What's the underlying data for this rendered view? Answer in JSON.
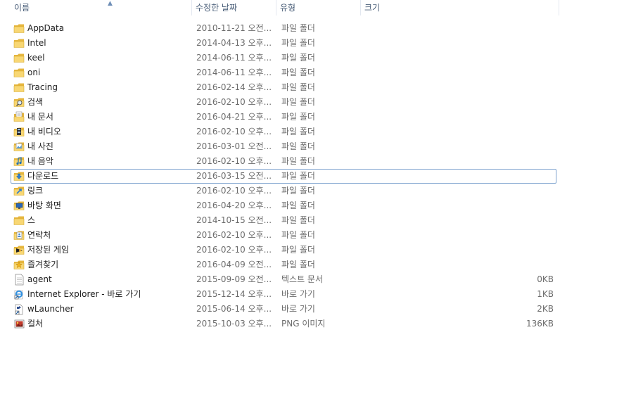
{
  "columns": {
    "name": "이름",
    "date": "수정한 날짜",
    "type": "유형",
    "size": "크기"
  },
  "colors": {
    "focus_border": "#7da2ce",
    "folder": "#f5cf5e",
    "header_text": "#4c607a",
    "detail_text": "#6d6d6d"
  },
  "items": [
    {
      "name": "AppData",
      "date": "2010-11-21 오전...",
      "type": "파일 폴더",
      "size": "",
      "icon": "folder-icon"
    },
    {
      "name": "Intel",
      "date": "2014-04-13 오후...",
      "type": "파일 폴더",
      "size": "",
      "icon": "folder-icon"
    },
    {
      "name": "keel",
      "date": "2014-06-11 오후...",
      "type": "파일 폴더",
      "size": "",
      "icon": "folder-icon"
    },
    {
      "name": "oni",
      "date": "2014-06-11 오후...",
      "type": "파일 폴더",
      "size": "",
      "icon": "folder-icon"
    },
    {
      "name": "Tracing",
      "date": "2016-02-14 오후...",
      "type": "파일 폴더",
      "size": "",
      "icon": "folder-icon"
    },
    {
      "name": "검색",
      "date": "2016-02-10 오후...",
      "type": "파일 폴더",
      "size": "",
      "icon": "search-folder-icon"
    },
    {
      "name": "내 문서",
      "date": "2016-04-21 오후...",
      "type": "파일 폴더",
      "size": "",
      "icon": "documents-folder-icon"
    },
    {
      "name": "내 비디오",
      "date": "2016-02-10 오후...",
      "type": "파일 폴더",
      "size": "",
      "icon": "videos-folder-icon"
    },
    {
      "name": "내 사진",
      "date": "2016-03-01 오전...",
      "type": "파일 폴더",
      "size": "",
      "icon": "pictures-folder-icon"
    },
    {
      "name": "내 음악",
      "date": "2016-02-10 오후...",
      "type": "파일 폴더",
      "size": "",
      "icon": "music-folder-icon"
    },
    {
      "name": "다운로드",
      "date": "2016-03-15 오전...",
      "type": "파일 폴더",
      "size": "",
      "icon": "downloads-folder-icon",
      "focused": true
    },
    {
      "name": "링크",
      "date": "2016-02-10 오후...",
      "type": "파일 폴더",
      "size": "",
      "icon": "links-folder-icon"
    },
    {
      "name": "바탕 화면",
      "date": "2016-04-20 오후...",
      "type": "파일 폴더",
      "size": "",
      "icon": "desktop-folder-icon"
    },
    {
      "name": "스",
      "date": "2014-10-15 오전...",
      "type": "파일 폴더",
      "size": "",
      "icon": "folder-icon"
    },
    {
      "name": "연락처",
      "date": "2016-02-10 오후...",
      "type": "파일 폴더",
      "size": "",
      "icon": "contacts-folder-icon"
    },
    {
      "name": "저장된 게임",
      "date": "2016-02-10 오후...",
      "type": "파일 폴더",
      "size": "",
      "icon": "saved-games-folder-icon"
    },
    {
      "name": "즐겨찾기",
      "date": "2016-04-09 오전...",
      "type": "파일 폴더",
      "size": "",
      "icon": "favorites-folder-icon"
    },
    {
      "name": "agent",
      "date": "2015-09-09 오전...",
      "type": "텍스트 문서",
      "size": "0KB",
      "icon": "text-document-icon"
    },
    {
      "name": "Internet Explorer - 바로 가기",
      "date": "2015-12-14 오후...",
      "type": "바로 가기",
      "size": "1KB",
      "icon": "internet-explorer-shortcut-icon"
    },
    {
      "name": "wLauncher",
      "date": "2015-06-14 오후...",
      "type": "바로 가기",
      "size": "2KB",
      "icon": "shortcut-icon"
    },
    {
      "name": "컬처",
      "date": "2015-10-03 오후...",
      "type": "PNG 이미지",
      "size": "136KB",
      "icon": "png-image-icon"
    }
  ]
}
